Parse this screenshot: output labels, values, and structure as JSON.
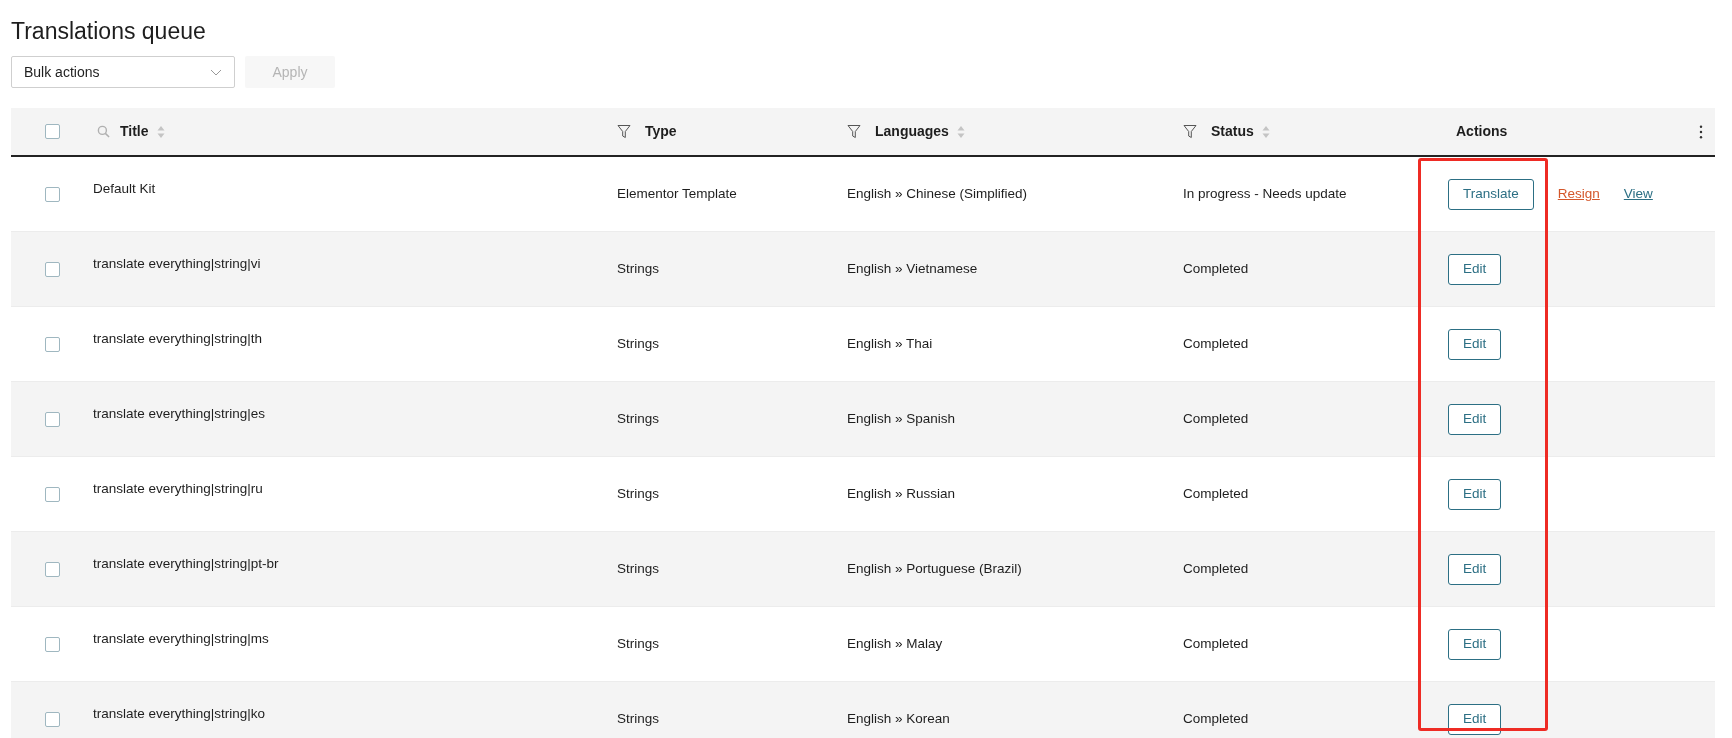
{
  "page_title": "Translations queue",
  "bulk_actions": {
    "value": "Bulk actions"
  },
  "apply_button": {
    "label": "Apply",
    "disabled": true
  },
  "table": {
    "select_all": {
      "checked": false
    },
    "columns": [
      {
        "label": "Title",
        "kind": "search",
        "sortable": true
      },
      {
        "label": "Type",
        "kind": "filter",
        "sortable": false
      },
      {
        "label": "Languages",
        "kind": "filter",
        "sortable": true
      },
      {
        "label": "Status",
        "kind": "filter",
        "sortable": true
      },
      {
        "label": "Actions",
        "kind": "plain",
        "sortable": false
      }
    ],
    "rows": [
      {
        "checked": false,
        "title": "Default Kit",
        "type": "Elementor Template",
        "languages": "English » Chinese (Simplified)",
        "status": "In progress - Needs update",
        "actions": [
          {
            "kind": "button",
            "label": "Translate"
          },
          {
            "kind": "link",
            "label": "Resign",
            "color": "#d4572b"
          },
          {
            "kind": "link",
            "label": "View",
            "color": "#2c6f84"
          }
        ]
      },
      {
        "checked": false,
        "title": "translate everything|string|vi",
        "type": "Strings",
        "languages": "English » Vietnamese",
        "status": "Completed",
        "actions": [
          {
            "kind": "button",
            "label": "Edit"
          }
        ]
      },
      {
        "checked": false,
        "title": "translate everything|string|th",
        "type": "Strings",
        "languages": "English » Thai",
        "status": "Completed",
        "actions": [
          {
            "kind": "button",
            "label": "Edit"
          }
        ]
      },
      {
        "checked": false,
        "title": "translate everything|string|es",
        "type": "Strings",
        "languages": "English » Spanish",
        "status": "Completed",
        "actions": [
          {
            "kind": "button",
            "label": "Edit"
          }
        ]
      },
      {
        "checked": false,
        "title": "translate everything|string|ru",
        "type": "Strings",
        "languages": "English » Russian",
        "status": "Completed",
        "actions": [
          {
            "kind": "button",
            "label": "Edit"
          }
        ]
      },
      {
        "checked": false,
        "title": "translate everything|string|pt-br",
        "type": "Strings",
        "languages": "English » Portuguese (Brazil)",
        "status": "Completed",
        "actions": [
          {
            "kind": "button",
            "label": "Edit"
          }
        ]
      },
      {
        "checked": false,
        "title": "translate everything|string|ms",
        "type": "Strings",
        "languages": "English » Malay",
        "status": "Completed",
        "actions": [
          {
            "kind": "button",
            "label": "Edit"
          }
        ]
      },
      {
        "checked": false,
        "title": "translate everything|string|ko",
        "type": "Strings",
        "languages": "English » Korean",
        "status": "Completed",
        "actions": [
          {
            "kind": "button",
            "label": "Edit"
          }
        ]
      }
    ]
  }
}
